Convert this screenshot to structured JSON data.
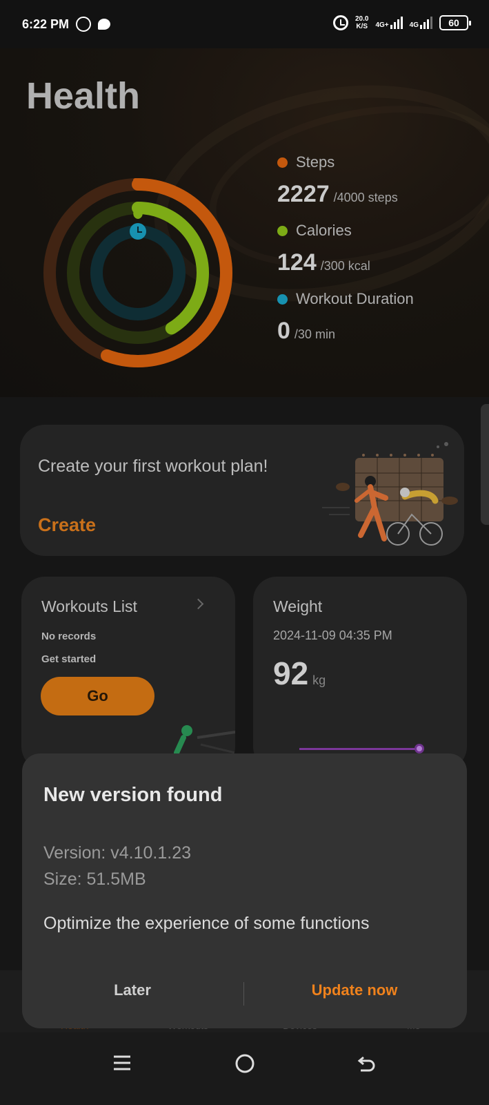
{
  "status_bar": {
    "time": "6:22 PM",
    "speed_top": "20.0",
    "speed_bottom": "K/S",
    "net1": "4G+",
    "net2": "4G",
    "battery": "60"
  },
  "header": {
    "title": "Health"
  },
  "stats": {
    "steps": {
      "label": "Steps",
      "value": "2227",
      "goal": "/4000 steps",
      "color": "#e0650f",
      "progress": 0.557
    },
    "calories": {
      "label": "Calories",
      "value": "124",
      "goal": "/300 kcal",
      "color": "#8fc31a",
      "progress": 0.413
    },
    "workout": {
      "label": "Workout Duration",
      "value": "0",
      "goal": "/30 min",
      "color": "#1ba6c9",
      "progress": 0
    }
  },
  "plan_card": {
    "text": "Create your first workout plan!",
    "action": "Create"
  },
  "workouts_card": {
    "title": "Workouts List",
    "line1": "No records",
    "line2": "Get started",
    "button": "Go"
  },
  "weight_card": {
    "title": "Weight",
    "date": "2024-11-09 04:35 PM",
    "value": "92",
    "unit": "kg"
  },
  "bottom_nav": {
    "items": [
      "Health",
      "Workouts",
      "Devices",
      "Me"
    ]
  },
  "dialog": {
    "title": "New version found",
    "version": "Version: v4.10.1.23",
    "size": "Size: 51.5MB",
    "description": "Optimize the experience of some functions",
    "later": "Later",
    "update": "Update now"
  },
  "accent_color": "#e07b15"
}
